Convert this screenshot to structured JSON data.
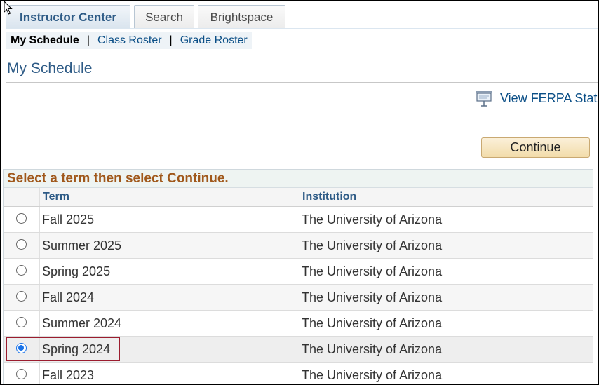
{
  "tabs": [
    {
      "label": "Instructor Center"
    },
    {
      "label": "Search"
    },
    {
      "label": "Brightspace"
    }
  ],
  "subnav": {
    "current": "My Schedule",
    "separator": "|",
    "links": [
      {
        "label": "Class Roster"
      },
      {
        "label": "Grade Roster"
      }
    ]
  },
  "page": {
    "title": "My Schedule",
    "ferpa_link": "View FERPA Stat",
    "continue_label": "Continue"
  },
  "grid": {
    "title": "Select a term then select Continue.",
    "headers": {
      "term": "Term",
      "institution": "Institution"
    },
    "rows": [
      {
        "term": "Fall 2025",
        "institution": "The University of Arizona",
        "selected": false
      },
      {
        "term": "Summer 2025",
        "institution": "The University of Arizona",
        "selected": false
      },
      {
        "term": "Spring 2025",
        "institution": "The University of Arizona",
        "selected": false
      },
      {
        "term": "Fall 2024",
        "institution": "The University of Arizona",
        "selected": false
      },
      {
        "term": "Summer 2024",
        "institution": "The University of Arizona",
        "selected": false
      },
      {
        "term": "Spring 2024",
        "institution": "The University of Arizona",
        "selected": true
      },
      {
        "term": "Fall 2023",
        "institution": "The University of Arizona",
        "selected": false
      }
    ]
  },
  "colors": {
    "accent": "#2e5b86",
    "link": "#0a4e86",
    "grid_title": "#a0581b",
    "highlight": "#9b1c2e",
    "radio_selected": "#1a73e8"
  }
}
